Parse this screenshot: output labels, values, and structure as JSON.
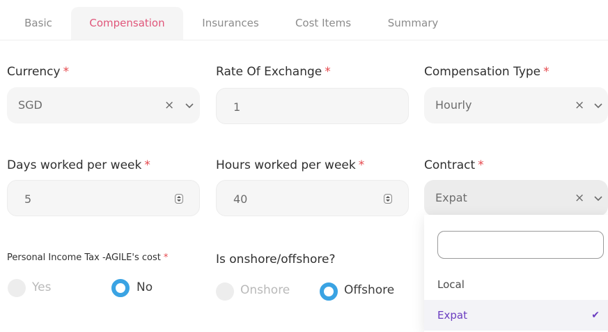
{
  "tabs": [
    "Basic",
    "Compensation",
    "Insurances",
    "Cost Items",
    "Summary"
  ],
  "form": {
    "currency": {
      "label": "Currency",
      "value": "SGD"
    },
    "rate_of_exchange": {
      "label": "Rate Of Exchange",
      "value": "1"
    },
    "compensation_type": {
      "label": "Compensation Type",
      "value": "Hourly"
    },
    "days_per_week": {
      "label": "Days worked per week",
      "value": "5"
    },
    "hours_per_week": {
      "label": "Hours worked per week",
      "value": "40"
    },
    "contract": {
      "label": "Contract",
      "value": "Expat"
    },
    "income_tax": {
      "label": "Personal Income Tax -AGILE's cost",
      "options": [
        "Yes",
        "No"
      ],
      "selected": "No"
    },
    "shore": {
      "label": "Is onshore/offshore?",
      "options": [
        "Onshore",
        "Offshore"
      ],
      "selected": "Offshore"
    },
    "required_marker": "*",
    "clear_glyph": "×"
  },
  "contract_dropdown": {
    "search_placeholder": "",
    "options": [
      "Local",
      "Expat"
    ],
    "selected": "Expat",
    "check_glyph": "✔"
  },
  "colors": {
    "active_tab": "#e0567a",
    "required": "#e5484d",
    "radio_checked": "#3aa3e3",
    "selected_option": "#6a3cc0"
  }
}
